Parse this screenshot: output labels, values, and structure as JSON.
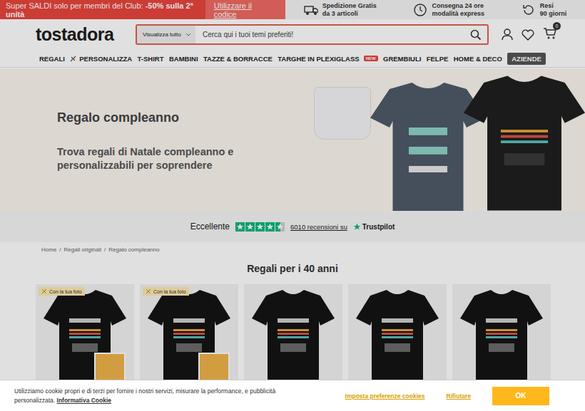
{
  "promo_bar": {
    "text": "Super SALDI solo per membri del Club:",
    "highlight": "-50% sulla 2ª unità",
    "link": "Utilizzare il codice"
  },
  "perks": [
    {
      "line1": "Spedizione Gratis",
      "line2": "da 3 articoli"
    },
    {
      "line1": "Consegna 24 ore",
      "line2": "modalità express"
    },
    {
      "line1": "Resi",
      "line2": "90 giorni"
    }
  ],
  "header": {
    "logo": "tostadora",
    "search_scope": "Visualizza tutto",
    "search_placeholder": "Cerca qui i tuoi temi preferiti!",
    "cart_count": "0"
  },
  "nav": [
    {
      "label": "REGALI",
      "kind": "plain"
    },
    {
      "label": "PERSONALIZZA",
      "kind": "icon"
    },
    {
      "label": "T-SHIRT",
      "kind": "plain"
    },
    {
      "label": "BAMBINI",
      "kind": "plain"
    },
    {
      "label": "TAZZE & BORRACCE",
      "kind": "plain"
    },
    {
      "label": "TARGHE IN PLEXIGLASS",
      "kind": "new",
      "badge": "NEW"
    },
    {
      "label": "GREMBIULI",
      "kind": "plain"
    },
    {
      "label": "FELPE",
      "kind": "plain"
    },
    {
      "label": "HOME & DECO",
      "kind": "plain"
    },
    {
      "label": "AZIENDE",
      "kind": "boxed"
    }
  ],
  "hero": {
    "title": "Regalo compleanno",
    "subtitle": "Trova regali di Natale compleanno e personalizzabili per soprendere"
  },
  "trustpilot": {
    "rating_label": "Eccellente",
    "stars": 4.5,
    "reviews": "6010 recensioni su",
    "brand": "Trustpilot"
  },
  "breadcrumb": [
    "Home",
    "Regali originali",
    "Regalo compleanno"
  ],
  "section_title": "Regali per i 40 anni",
  "products": [
    {
      "kind": "custom",
      "badge": "Con la tua foto"
    },
    {
      "kind": "custom",
      "badge": "Con la tua foto"
    },
    {
      "kind": "standard"
    },
    {
      "kind": "standard"
    },
    {
      "kind": "standard"
    }
  ],
  "cookie_banner": {
    "text": "Utilizziamo cookie propri e di terzi per fornire i nostri servizi, misurare la performance, e pubblicità personalizzata.",
    "link": "Informativa Cookie",
    "preferences": "Imposta preferenze cookies",
    "reject": "Rifiutare",
    "accept": "OK"
  }
}
